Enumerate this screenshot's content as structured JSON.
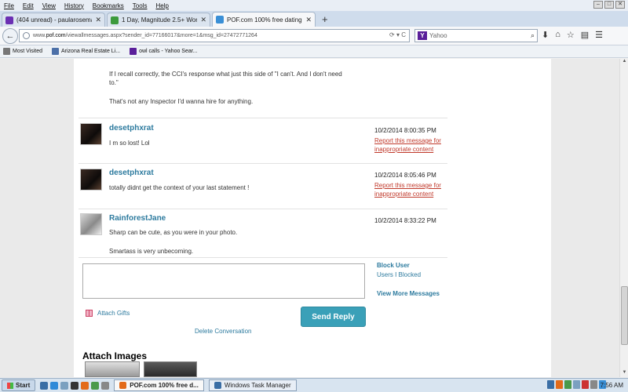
{
  "menubar": {
    "items": [
      "File",
      "Edit",
      "View",
      "History",
      "Bookmarks",
      "Tools",
      "Help"
    ]
  },
  "tabs": [
    {
      "label": "(404 unread) - paularosemag...",
      "color": "#6b2fb3"
    },
    {
      "label": "1 Day, Magnitude 2.5+ World...",
      "color": "#3c9a3c"
    },
    {
      "label": "POF.com 100% free dating site",
      "color": "#3a8fd6",
      "active": true
    }
  ],
  "navbar": {
    "url_prefix": "www.",
    "url_host": "pof.com",
    "url_path": "/viewallmessages.aspx?sender_id=77166017&more=1&msg_id=27472771264",
    "search_placeholder": "Yahoo",
    "search_brand": "Y"
  },
  "bookmarks": [
    {
      "label": "Most Visited",
      "color": "#777"
    },
    {
      "label": "Arizona Real Estate Li...",
      "color": "#4c70a8"
    },
    {
      "label": "owl calls - Yahoo Sear...",
      "color": "#5a1f9a"
    }
  ],
  "prior_message": {
    "lines": [
      "If I recall correctly, the CCI's response what just this side of \"I can't. And I don't need",
      "to.\""
    ],
    "line3": "That's not any Inspector I'd wanna hire for anything."
  },
  "messages": [
    {
      "user": "desetphxrat",
      "time": "10/2/2014 8:00:35 PM",
      "text": "I m so lost! Lol",
      "report1": "Report this message for",
      "report2": "inappropriate content"
    },
    {
      "user": "desetphxrat",
      "time": "10/2/2014 8:05:46 PM",
      "text": "totally didnt get the context of your last statement !",
      "report1": "Report this message for",
      "report2": "inappropriate content"
    },
    {
      "user": "RainforestJane",
      "time": "10/2/2014 8:33:22 PM",
      "text": "Sharp can be cute, as you were in your photo.",
      "text2": "Smartass is very unbecoming."
    }
  ],
  "side": {
    "block_user": "Block User",
    "users_blocked": "Users I Blocked",
    "view_more": "View More Messages"
  },
  "actions": {
    "attach_gifts": "Attach Gifts",
    "send_reply": "Send Reply",
    "delete_conversation": "Delete Conversation",
    "attach_images": "Attach Images"
  },
  "taskbar": {
    "start": "Start",
    "tasks": [
      {
        "label": "POF.com 100% free d...",
        "active": true,
        "color": "#e36b1a"
      },
      {
        "label": "Windows Task Manager",
        "active": false,
        "color": "#3a6ea5"
      }
    ],
    "clock": "7:56 AM"
  }
}
